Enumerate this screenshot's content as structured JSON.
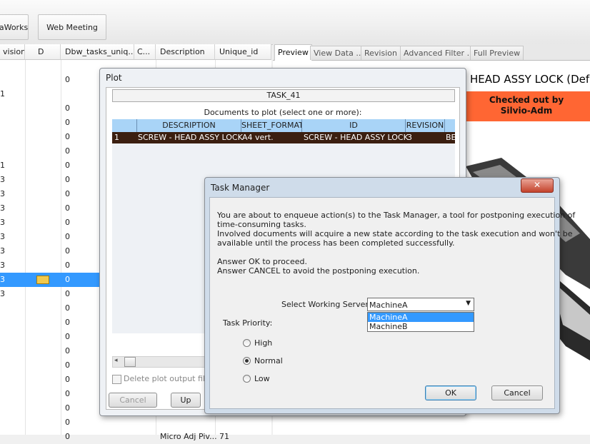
{
  "toolbar": {
    "btn1_label": "aWorks",
    "btn2_label": "Web Meeting"
  },
  "grid": {
    "headers": [
      "vision",
      "D",
      "Dbw_tasks_uniq...",
      "C...",
      "Description",
      "Unique_id"
    ],
    "rows": [
      {
        "vision": "",
        "col3": "0",
        "desc": "",
        "uid": ""
      },
      {
        "vision": "1",
        "col3": "",
        "desc": "",
        "uid": ""
      },
      {
        "vision": "",
        "col3": "0",
        "desc": "",
        "uid": ""
      },
      {
        "vision": "",
        "col3": "0",
        "desc": "",
        "uid": ""
      },
      {
        "vision": "",
        "col3": "0",
        "desc": "",
        "uid": ""
      },
      {
        "vision": "",
        "col3": "0",
        "desc": "",
        "uid": ""
      },
      {
        "vision": "1",
        "col3": "0",
        "desc": "",
        "uid": ""
      },
      {
        "vision": "3",
        "col3": "0",
        "desc": "",
        "uid": ""
      },
      {
        "vision": "3",
        "col3": "0",
        "desc": "",
        "uid": ""
      },
      {
        "vision": "3",
        "col3": "0",
        "desc": "",
        "uid": ""
      },
      {
        "vision": "3",
        "col3": "0",
        "desc": "",
        "uid": ""
      },
      {
        "vision": "3",
        "col3": "0",
        "desc": "",
        "uid": ""
      },
      {
        "vision": "3",
        "col3": "0",
        "desc": "",
        "uid": ""
      },
      {
        "vision": "3",
        "col3": "0",
        "desc": "",
        "uid": ""
      },
      {
        "vision": "3",
        "col3": "0",
        "desc": "",
        "uid": ""
      },
      {
        "vision": "3",
        "col3": "0",
        "desc": "",
        "uid": ""
      },
      {
        "vision": "",
        "col3": "0",
        "desc": "",
        "uid": ""
      },
      {
        "vision": "",
        "col3": "0",
        "desc": "",
        "uid": ""
      },
      {
        "vision": "",
        "col3": "0",
        "desc": "",
        "uid": ""
      },
      {
        "vision": "",
        "col3": "0",
        "desc": "",
        "uid": ""
      },
      {
        "vision": "",
        "col3": "0",
        "desc": "",
        "uid": ""
      },
      {
        "vision": "",
        "col3": "0",
        "desc": "",
        "uid": ""
      },
      {
        "vision": "",
        "col3": "0",
        "desc": "",
        "uid": ""
      },
      {
        "vision": "",
        "col3": "0",
        "desc": "",
        "uid": ""
      },
      {
        "vision": "",
        "col3": "0",
        "desc": "",
        "uid": ""
      },
      {
        "vision": "",
        "col3": "0",
        "desc": "Micro Adj Piv...",
        "uid": "71"
      }
    ],
    "selected_index": 14
  },
  "tabs": [
    "Preview",
    "View Data ...",
    "Revision",
    "Advanced Filter ...",
    "Full Preview"
  ],
  "preview": {
    "title": "HEAD ASSY LOCK (Defa",
    "checked_out_line1": "Checked out by",
    "checked_out_line2": "Silvio-Adm",
    "accent_color": "#ff6633"
  },
  "plot": {
    "title": "Plot",
    "task_name": "TASK_41",
    "docs_label": "Documents to plot (select one or more):",
    "columns": [
      "DESCRIPTION",
      "SHEET_FORMAT",
      "ID",
      "REVISION"
    ],
    "row": {
      "num": "1",
      "description": "SCREW - HEAD ASSY LOCK",
      "sheet_format": "A4 vert.",
      "id": "SCREW - HEAD ASSY LOCK",
      "revision": "3",
      "extra": "BE"
    },
    "delete_label": "Delete plot output files b",
    "cancel_label": "Cancel",
    "up_label": "Up"
  },
  "task_manager": {
    "title": "Task Manager",
    "msg1": "You are about to enqueue action(s) to the Task Manager, a tool for postponing execution of",
    "msg2": "time-consuming tasks.",
    "msg3": "Involved documents will acquire a new state according to the task execution and won't be",
    "msg4": "available until the process has been completed successfully.",
    "msg5": "Answer OK to proceed.",
    "msg6": "Answer CANCEL to avoid the postponing execution.",
    "server_label": "Select Working Server:",
    "server_value": "MachineA",
    "server_options": [
      "MachineA",
      "MachineB"
    ],
    "priority_label": "Task Priority:",
    "priority_high": "High",
    "priority_normal": "Normal",
    "priority_low": "Low",
    "priority_selected": "Normal",
    "ok_label": "OK",
    "cancel_label": "Cancel"
  }
}
